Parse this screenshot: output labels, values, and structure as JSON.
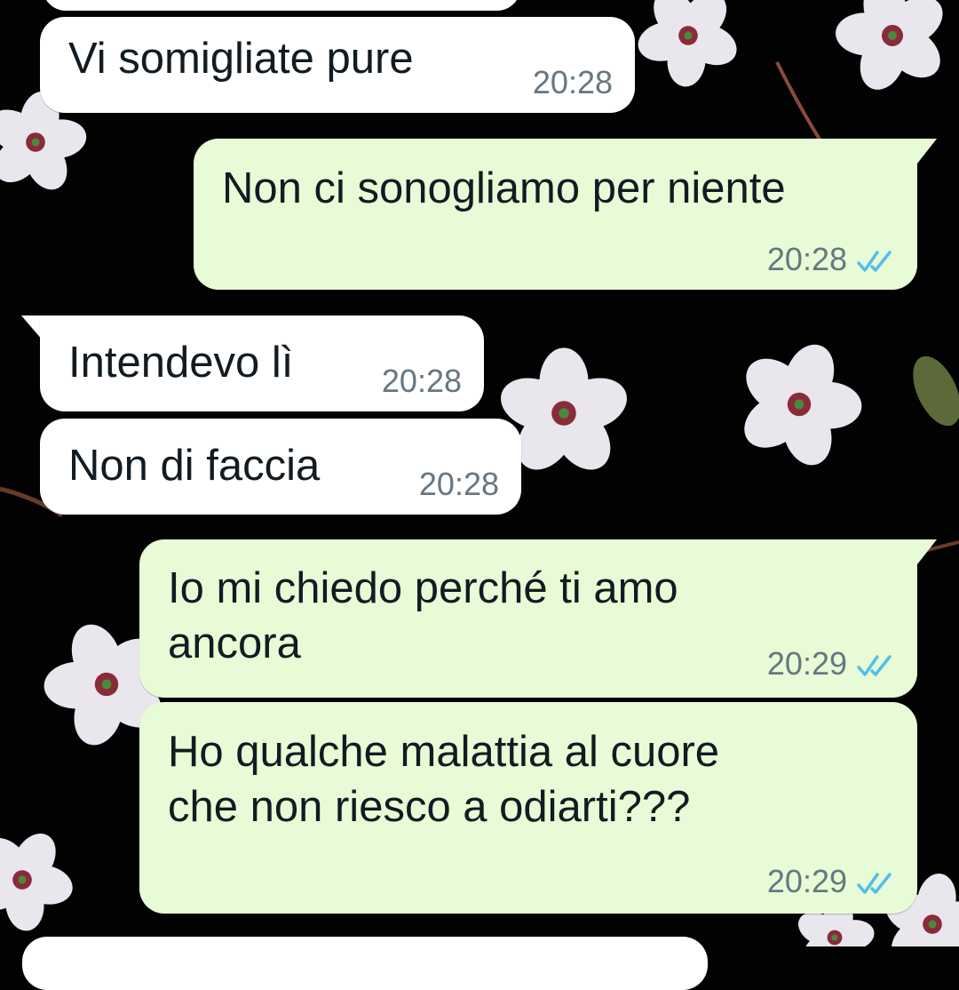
{
  "colors": {
    "wallpaper": "#020202",
    "incoming_bubble": "#ffffff",
    "outgoing_bubble": "#e7fcd6",
    "timestamp": "#667781",
    "read_ticks": "#53bdeb"
  },
  "icons": {
    "read_receipt": "double-check-icon"
  },
  "messages": [
    {
      "direction": "incoming",
      "text": "Vi somigliate pure",
      "time": "20:28"
    },
    {
      "direction": "outgoing",
      "text": "Non ci sonogliamo per niente",
      "time": "20:28",
      "status": "read"
    },
    {
      "direction": "incoming",
      "text": "Intendevo lì",
      "time": "20:28"
    },
    {
      "direction": "incoming",
      "text": "Non di faccia",
      "time": "20:28"
    },
    {
      "direction": "outgoing",
      "text": "Io mi chiedo perché ti amo\nancora",
      "time": "20:29",
      "status": "read"
    },
    {
      "direction": "outgoing",
      "text": "Ho qualche malattia al cuore\nche non riesco a odiarti???",
      "time": "20:29",
      "status": "read"
    }
  ]
}
